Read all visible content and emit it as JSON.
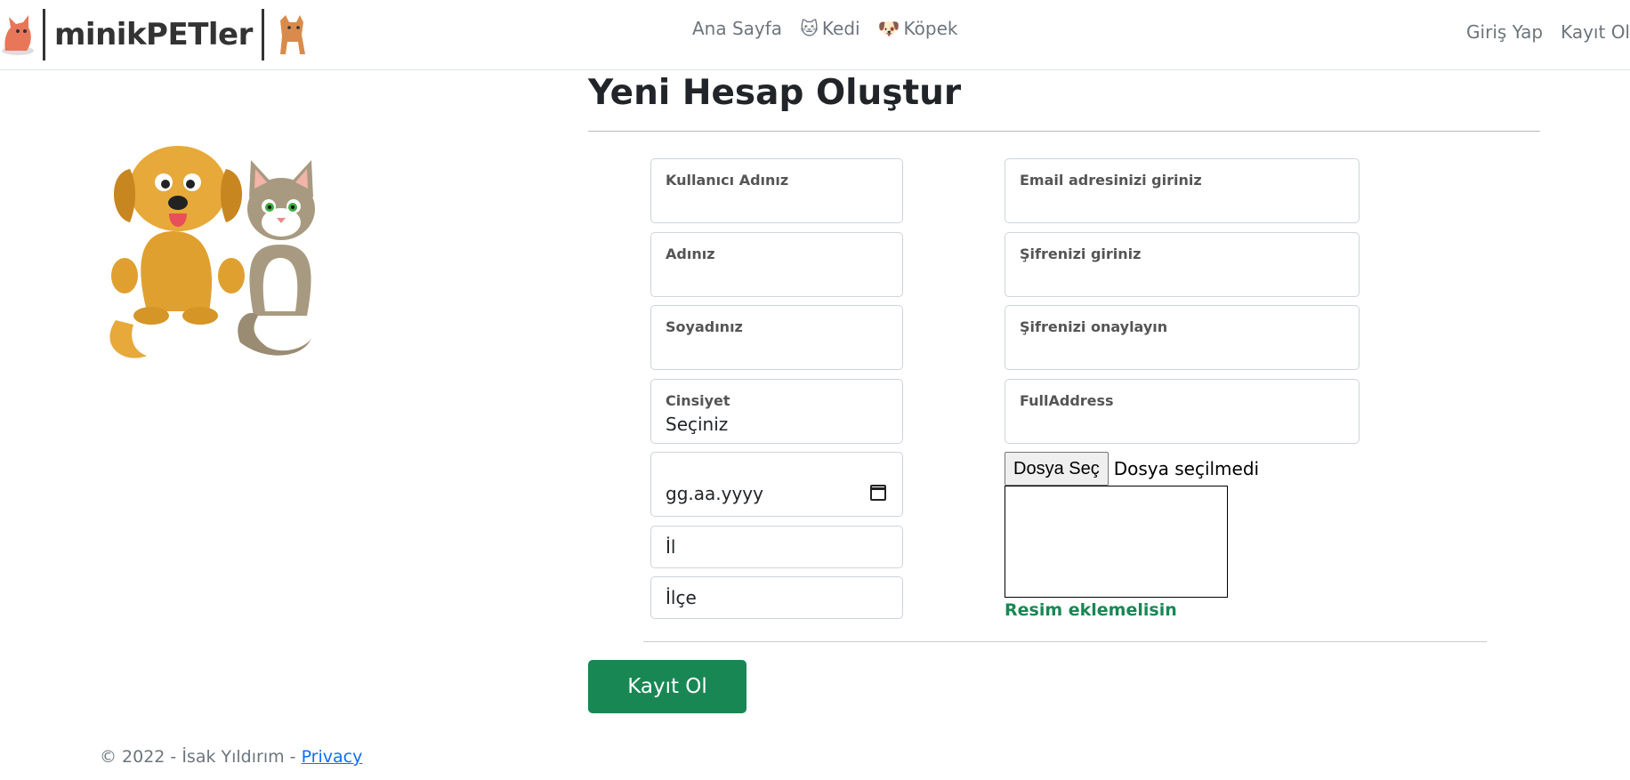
{
  "brand": {
    "name": "minikPETler"
  },
  "nav": {
    "home": "Ana Sayfa",
    "cat": "Kedi",
    "dog": "Köpek",
    "login": "Giriş Yap",
    "register": "Kayıt Ol"
  },
  "page": {
    "title": "Yeni Hesap Oluştur"
  },
  "form": {
    "username_label": "Kullanıcı Adınız",
    "name_label": "Adınız",
    "surname_label": "Soyadınız",
    "gender_label": "Cinsiyet",
    "gender_value": "Seçiniz",
    "birthdate_placeholder": "gg.aa.yyyy",
    "city_placeholder": "İl",
    "district_placeholder": "İlçe",
    "email_label": "Email adresinizi giriniz",
    "password_label": "Şifrenizi giriniz",
    "password_confirm_label": "Şifrenizi onaylayın",
    "address_label": "FullAddress",
    "file_button": "Dosya Seç",
    "file_status": "Dosya seçilmedi",
    "image_error": "Resim eklemelisin",
    "submit": "Kayıt Ol"
  },
  "footer": {
    "copyright": "© 2022 - İsak Yıldırım - ",
    "privacy": "Privacy"
  },
  "colors": {
    "accent": "#198754",
    "link": "#0d6efd",
    "nav_text": "#6c757d"
  }
}
